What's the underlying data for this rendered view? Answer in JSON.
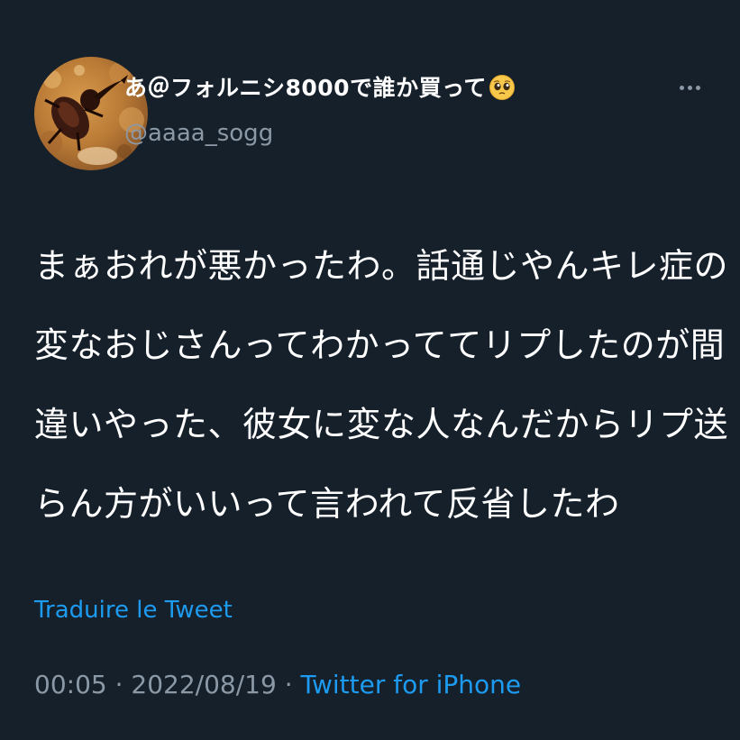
{
  "tweet": {
    "display_name": "あ＠フォルニシ8000で誰か買って",
    "display_name_emoji": "pleading-face-emoji",
    "handle": "@aaaa_sogg",
    "more_icon": "more-options-icon",
    "text_lines": [
      "まぁおれが悪かったわ。話通じやんキレ症の",
      "変なおじさんってわかっててリプしたのが間",
      "違いやった、彼女に変な人なんだからリプ送",
      "らん方がいいって言われて反省したわ"
    ],
    "translate_label": "Traduire le Tweet",
    "time": "00:05",
    "separator_1": " · ",
    "date": "2022/08/19",
    "separator_2": " · ",
    "source": "Twitter for iPhone"
  },
  "colors": {
    "background": "#15202b",
    "text": "#ffffff",
    "secondary": "#8b98a5",
    "link": "#1d9bf0"
  }
}
